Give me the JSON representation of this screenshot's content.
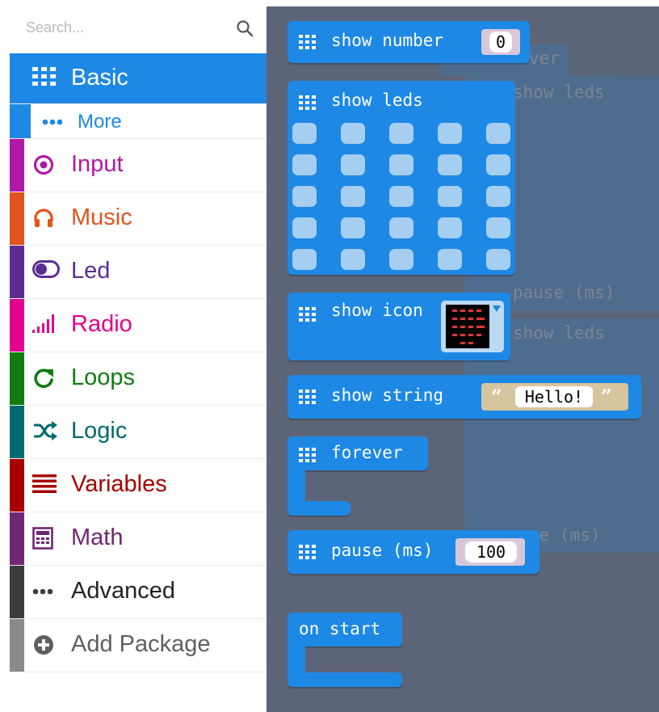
{
  "search": {
    "placeholder": "Search..."
  },
  "categories": [
    {
      "id": "basic",
      "label": "Basic",
      "icon": "grid-icon",
      "color": "#1e88e5",
      "selected": true
    },
    {
      "id": "more",
      "label": "More",
      "icon": "dots-icon",
      "color": "#1e88e5",
      "sub": true
    },
    {
      "id": "input",
      "label": "Input",
      "icon": "target-icon",
      "color": "#b018a8"
    },
    {
      "id": "music",
      "label": "Music",
      "icon": "headphones-icon",
      "color": "#e1541d"
    },
    {
      "id": "led",
      "label": "Led",
      "icon": "toggle-icon",
      "color": "#5c2d91"
    },
    {
      "id": "radio",
      "label": "Radio",
      "icon": "signal-bars-icon",
      "color": "#e3008c"
    },
    {
      "id": "loops",
      "label": "Loops",
      "icon": "refresh-icon",
      "color": "#107c10"
    },
    {
      "id": "logic",
      "label": "Logic",
      "icon": "shuffle-icon",
      "color": "#006970"
    },
    {
      "id": "variables",
      "label": "Variables",
      "icon": "lines-icon",
      "color": "#a80000"
    },
    {
      "id": "math",
      "label": "Math",
      "icon": "calculator-icon",
      "color": "#712672"
    },
    {
      "id": "advanced",
      "label": "Advanced",
      "icon": "dots-icon",
      "color": "#3c3c3c"
    },
    {
      "id": "add-package",
      "label": "Add Package",
      "icon": "plus-circle-icon",
      "color": "#6f6f6f"
    }
  ],
  "blocks": {
    "show_number": {
      "label": "show number",
      "value": "0"
    },
    "show_leds": {
      "label": "show leds",
      "leds": [
        [
          0,
          0,
          0,
          0,
          0
        ],
        [
          0,
          0,
          0,
          0,
          0
        ],
        [
          0,
          0,
          0,
          0,
          0
        ],
        [
          0,
          0,
          0,
          0,
          0
        ],
        [
          0,
          0,
          0,
          0,
          0
        ]
      ]
    },
    "show_icon": {
      "label": "show icon"
    },
    "show_string": {
      "label": "show string",
      "value": "Hello!",
      "open_quote": "“",
      "close_quote": "”"
    },
    "forever": {
      "label": "forever"
    },
    "pause": {
      "label": "pause (ms)",
      "value": "100"
    },
    "on_start": {
      "label": "on start"
    }
  },
  "workspace_ghosts": {
    "forever_text": "ver",
    "show_leds_text": "show leds",
    "pause_text": "pause (ms)",
    "pause_text_2": "se (ms)"
  },
  "colors": {
    "block": "#1e88e5",
    "workspace": "#5b6577",
    "led_off": "#a6cef0",
    "led_on": "#e53935"
  }
}
